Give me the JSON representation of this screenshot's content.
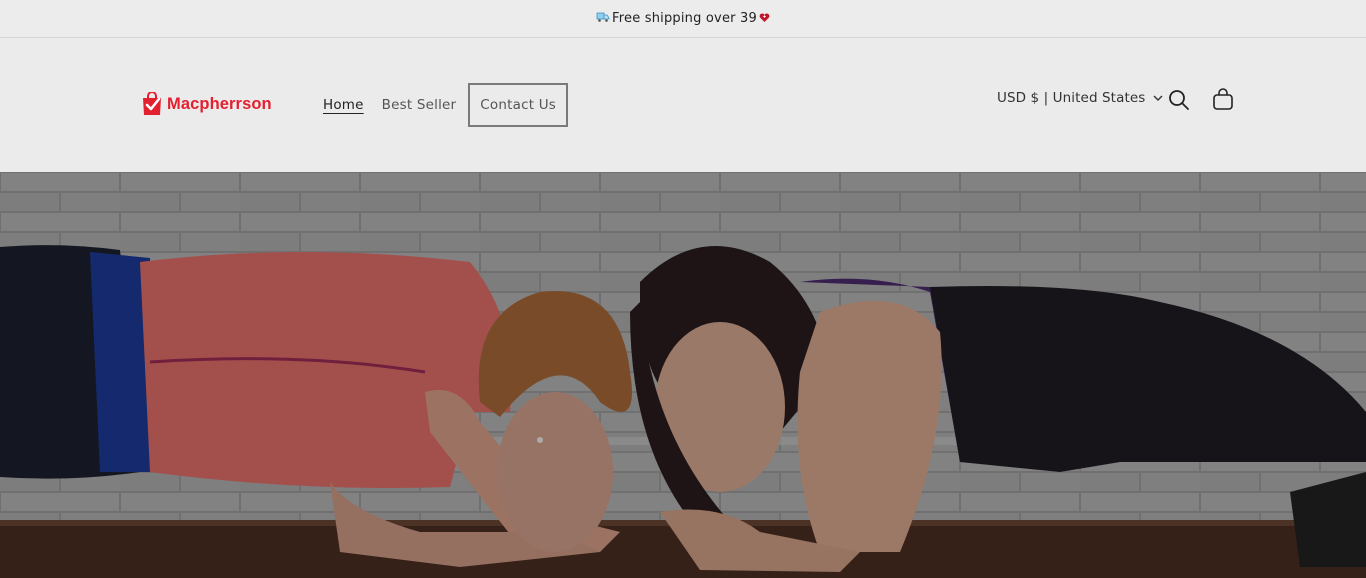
{
  "announcement": {
    "text": "Free shipping over 39",
    "leading_icon": "truck-icon",
    "trailing_icon": "heart-icon"
  },
  "header": {
    "brand": "Macpherrson",
    "logo_icon": "shopping-bag-check-icon",
    "nav": [
      {
        "label": "Home",
        "active": true
      },
      {
        "label": "Best Seller",
        "active": false
      },
      {
        "label": "Contact Us",
        "active": false,
        "focused": true
      }
    ],
    "localization": {
      "label": "USD $ | United States"
    },
    "search_icon": "search-icon",
    "cart_icon": "cart-icon"
  },
  "hero": {
    "image": "two women doing plank exercise facing each other, fist bump"
  },
  "colors": {
    "brand_red": "#e3202f",
    "page_bg": "#ebebeb"
  }
}
